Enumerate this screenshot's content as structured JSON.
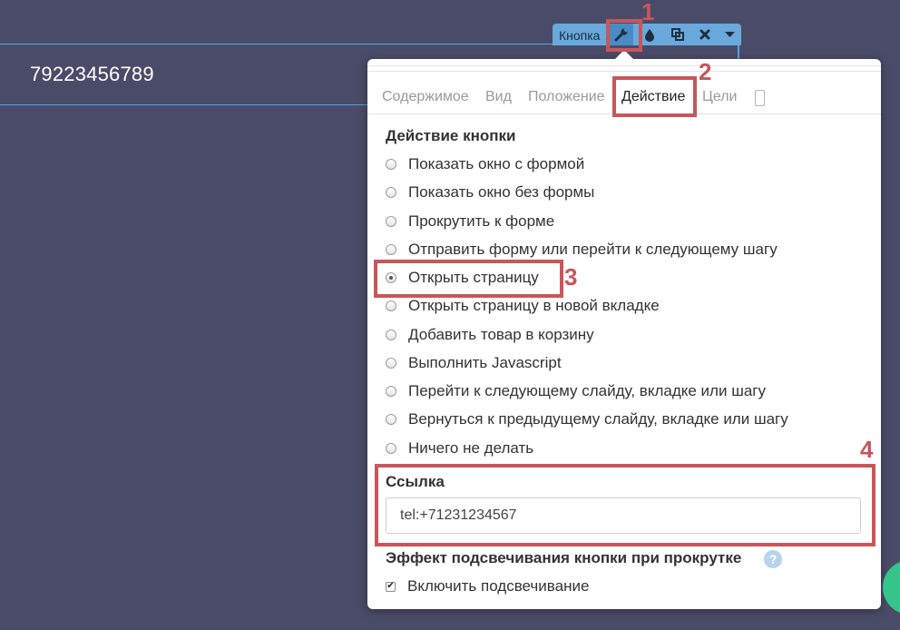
{
  "canvas": {
    "phone_text": "79223456789"
  },
  "toolbar": {
    "label": "Кнопка",
    "icons": [
      "wrench-icon",
      "drop-icon",
      "copy-icon",
      "close-icon",
      "caret-down-icon"
    ]
  },
  "annotations": [
    "1",
    "2",
    "3",
    "4"
  ],
  "popup": {
    "tabs": [
      "Содержимое",
      "Вид",
      "Положение",
      "Действие",
      "Цели"
    ],
    "active_tab": "Действие",
    "action_title": "Действие кнопки",
    "actions": [
      "Показать окно с формой",
      "Показать окно без формы",
      "Прокрутить к форме",
      "Отправить форму или перейти к следующему шагу",
      "Открыть страницу",
      "Открыть страницу в новой вкладке",
      "Добавить товар в корзину",
      "Выполнить Javascript",
      "Перейти к следующему слайду, вкладке или шагу",
      "Вернуться к предыдущему слайду, вкладке или шагу",
      "Ничего не делать"
    ],
    "selected_action": "Открыть страницу",
    "link_label": "Ссылка",
    "link_value": "tel:+71231234567",
    "effect_title": "Эффект подсвечивания кнопки при прокрутке",
    "help_glyph": "?",
    "highlight_checkbox_label": "Включить подсвечивание",
    "highlight_checked": true
  },
  "colors": {
    "background": "#4a4b68",
    "toolbar": "#69a9dc",
    "annotation": "#c9565a",
    "accent_green": "#36c48d"
  }
}
